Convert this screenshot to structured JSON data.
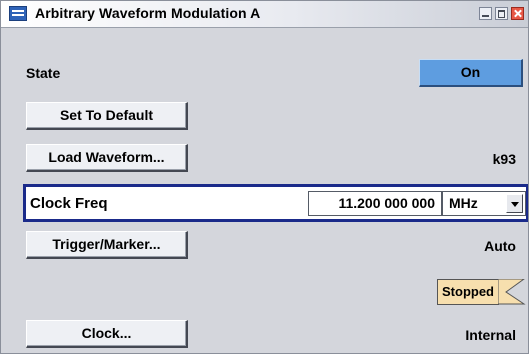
{
  "window": {
    "title": "Arbitrary Waveform Modulation  A"
  },
  "state": {
    "label": "State",
    "button_label": "On"
  },
  "set_default": {
    "label": "Set To Default"
  },
  "load_waveform": {
    "label": "Load Waveform...",
    "value": "k93"
  },
  "clock_freq": {
    "label": "Clock Freq",
    "value": "11.200 000 000",
    "unit": "MHz"
  },
  "trigger_marker": {
    "label": "Trigger/Marker...",
    "value": "Auto",
    "status": "Stopped"
  },
  "clock": {
    "label": "Clock...",
    "value": "Internal"
  },
  "colors": {
    "on_button": "#5e9de0",
    "focus_border": "#1a2a8a",
    "stopped_badge": "#f7dfae",
    "window_bg": "#d4d6dc"
  }
}
